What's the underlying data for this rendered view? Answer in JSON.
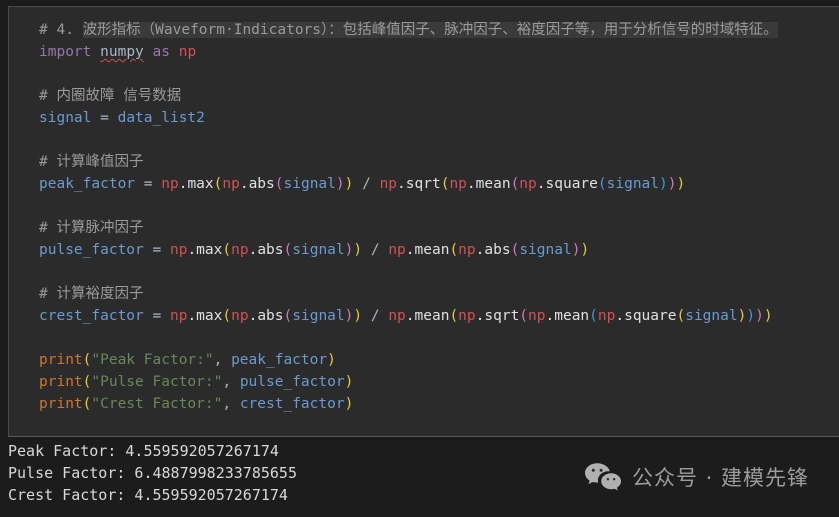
{
  "editor": {
    "background": "#2b2b2b",
    "lines": [
      {
        "type": "comment_highlight",
        "prefix": "# 4. ",
        "text": "波形指标（Waveform·Indicators）：包括峰值因子、脉冲因子、裕度因子等，用于分析信号的时域特征。"
      },
      {
        "type": "import",
        "kw1": "import",
        "module": "numpy",
        "kw2": "as",
        "alias": "np"
      },
      {
        "type": "blank"
      },
      {
        "type": "comment",
        "text": "# 内圈故障 信号数据"
      },
      {
        "type": "assign_simple",
        "target": "signal",
        "op": "=",
        "value": "data_list2"
      },
      {
        "type": "blank"
      },
      {
        "type": "comment",
        "text": "# 计算峰值因子"
      },
      {
        "type": "expr_peak",
        "target": "peak_factor"
      },
      {
        "type": "blank"
      },
      {
        "type": "comment",
        "text": "# 计算脉冲因子"
      },
      {
        "type": "expr_pulse",
        "target": "pulse_factor"
      },
      {
        "type": "blank"
      },
      {
        "type": "comment",
        "text": "# 计算裕度因子"
      },
      {
        "type": "expr_crest",
        "target": "crest_factor"
      },
      {
        "type": "blank"
      },
      {
        "type": "print",
        "func": "print",
        "string": "\"Peak Factor:\"",
        "arg": "peak_factor"
      },
      {
        "type": "print",
        "func": "print",
        "string": "\"Pulse Factor:\"",
        "arg": "pulse_factor"
      },
      {
        "type": "print",
        "func": "print",
        "string": "\"Crest Factor:\"",
        "arg": "crest_factor"
      }
    ],
    "tokens": {
      "np": "np",
      "dot": ".",
      "max": "max",
      "abs": "abs",
      "sqrt": "sqrt",
      "mean": "mean",
      "square": "square",
      "signal": "signal",
      "eq": " = ",
      "div": " / ",
      "comma": ", ",
      "lp": "(",
      "rp": ")"
    },
    "colors": {
      "comment": "#9a9a9a",
      "keyword": "#9876aa",
      "module": "#d25252",
      "variable": "#6897bb",
      "function": "#e0e0e0",
      "string": "#6a8759",
      "print": "#cc7832",
      "bracket_yellow": "#e8c840",
      "bracket_magenta": "#c679bf",
      "bracket_blue": "#3b9ad9",
      "error_underline": "#c75450"
    }
  },
  "console": {
    "background": "#1c1c1c",
    "lines": [
      "Peak Factor: 4.559592057267174",
      "Pulse Factor: 6.4887998233785655",
      "Crest Factor: 4.559592057267174"
    ],
    "results": {
      "peak_factor": "4.559592057267174",
      "pulse_factor": "6.4887998233785655",
      "crest_factor": "4.559592057267174"
    }
  },
  "watermark": {
    "icon": "wechat-icon",
    "text": "公众号 · 建模先锋",
    "color": "#9c9c9c"
  }
}
